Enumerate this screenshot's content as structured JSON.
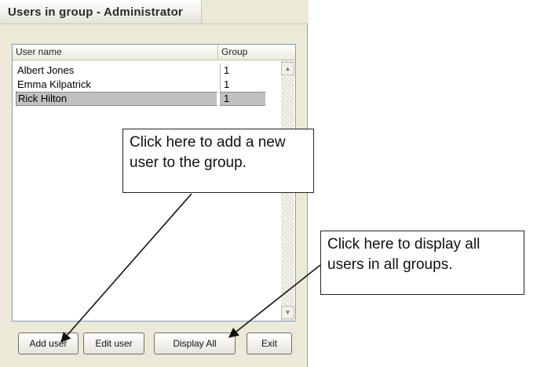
{
  "window": {
    "title": "Users in group - Administrator"
  },
  "list": {
    "columns": [
      "User name",
      "Group"
    ],
    "rows": [
      {
        "user": "Albert Jones",
        "group": "1",
        "selected": false
      },
      {
        "user": "Emma Kilpatrick",
        "group": "1",
        "selected": false
      },
      {
        "user": "Rick Hilton",
        "group": "1",
        "selected": true
      }
    ]
  },
  "scrollbar": {
    "up_icon": "▲",
    "down_icon": "▼"
  },
  "buttons": {
    "add": "Add user",
    "edit": "Edit user",
    "display_all": "Display All",
    "exit": "Exit"
  },
  "callouts": {
    "add_user": "Click here to add a new user to the group.",
    "display_all": "Click here to display all users in all groups."
  },
  "colors": {
    "window_bg": "#ece9d8",
    "selection": "#c0c0c0",
    "list_border": "#7f9db9"
  }
}
